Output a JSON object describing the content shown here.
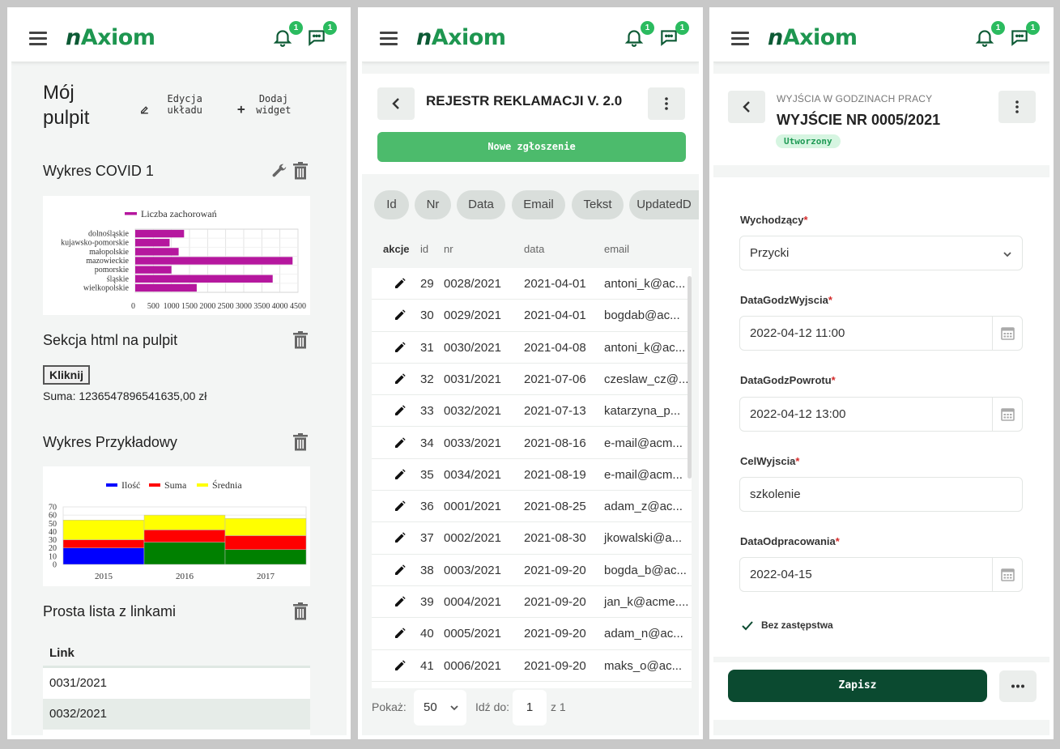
{
  "header": {
    "logo_prefix": "n",
    "logo_main": "Axiom",
    "notifications_count": "1",
    "messages_count": "1"
  },
  "dashboard": {
    "title": "Mój pulpit",
    "edit_layout_label": "Edycja układu",
    "add_widget_label": "Dodaj widget",
    "covid": {
      "title": "Wykres COVID 1",
      "chart_data": {
        "type": "bar",
        "orientation": "horizontal",
        "legend": [
          "Liczba zachorowań"
        ],
        "categories": [
          "dolnośląskie",
          "kujawsko-pomorskie",
          "małopolskie",
          "mazowieckie",
          "pomorskie",
          "śląskie",
          "wielkopolskie"
        ],
        "values": [
          1350,
          950,
          1200,
          4350,
          1000,
          3800,
          1700
        ],
        "x_ticks": [
          "0",
          "500",
          "1000",
          "1500",
          "2000",
          "2500",
          "3000",
          "3500",
          "4000",
          "4500"
        ],
        "xlim": [
          0,
          4500
        ],
        "color": "#b5179e"
      }
    },
    "html_section": {
      "title": "Sekcja html na pulpit",
      "button_label": "Kliknij",
      "sum_text": "Suma: 1236547896541635,00 zł"
    },
    "example_chart": {
      "title": "Wykres Przykładowy",
      "chart_data": {
        "type": "bar",
        "stacked": true,
        "categories": [
          "2015",
          "2016",
          "2017"
        ],
        "series": [
          {
            "name": "Ilość",
            "values": [
              20,
              27,
              18
            ],
            "color": "#0000ff"
          },
          {
            "name": "Suma",
            "values": [
              10,
              15,
              17
            ],
            "color": "#ff0000"
          },
          {
            "name": "Średnia",
            "values": [
              24,
              18,
              21
            ],
            "color": "#ffff00"
          }
        ],
        "y_ticks": [
          "0",
          "10",
          "20",
          "30",
          "40",
          "50",
          "60",
          "70"
        ],
        "ylim": [
          0,
          70
        ]
      }
    },
    "links": {
      "title": "Prosta lista z linkami",
      "column": "Link",
      "items": [
        "0031/2021",
        "0032/2021"
      ]
    }
  },
  "register": {
    "title": "REJESTR REKLAMACJI V. 2.0",
    "new_button": "Nowe zgłoszenie",
    "chips": [
      "Id",
      "Nr",
      "Data",
      "Email",
      "Tekst",
      "UpdatedD"
    ],
    "columns": [
      "akcje",
      "id",
      "nr",
      "data",
      "email"
    ],
    "rows": [
      {
        "id": "29",
        "nr": "0028/2021",
        "data": "2021-04-01",
        "email": "antoni_k@ac..."
      },
      {
        "id": "30",
        "nr": "0029/2021",
        "data": "2021-04-01",
        "email": "bogdab@ac..."
      },
      {
        "id": "31",
        "nr": "0030/2021",
        "data": "2021-04-08",
        "email": "antoni_k@ac..."
      },
      {
        "id": "32",
        "nr": "0031/2021",
        "data": "2021-07-06",
        "email": "czeslaw_cz@..."
      },
      {
        "id": "33",
        "nr": "0032/2021",
        "data": "2021-07-13",
        "email": "katarzyna_p..."
      },
      {
        "id": "34",
        "nr": "0033/2021",
        "data": "2021-08-16",
        "email": "e-mail@acm..."
      },
      {
        "id": "35",
        "nr": "0034/2021",
        "data": "2021-08-19",
        "email": "e-mail@acm..."
      },
      {
        "id": "36",
        "nr": "0001/2021",
        "data": "2021-08-25",
        "email": "adam_z@ac..."
      },
      {
        "id": "37",
        "nr": "0002/2021",
        "data": "2021-08-30",
        "email": "jkowalski@a..."
      },
      {
        "id": "38",
        "nr": "0003/2021",
        "data": "2021-09-20",
        "email": "bogda_b@ac..."
      },
      {
        "id": "39",
        "nr": "0004/2021",
        "data": "2021-09-20",
        "email": "jan_k@acme...."
      },
      {
        "id": "40",
        "nr": "0005/2021",
        "data": "2021-09-20",
        "email": "adam_n@ac..."
      },
      {
        "id": "41",
        "nr": "0006/2021",
        "data": "2021-09-20",
        "email": "maks_o@ac..."
      }
    ],
    "pager": {
      "show_label": "Pokaż:",
      "page_size": "50",
      "goto_label": "Idź do:",
      "page": "1",
      "of_label": "z 1"
    }
  },
  "exit_form": {
    "subtitle": "WYJŚCIA W GODZINACH PRACY",
    "title": "WYJŚCIE NR 0005/2021",
    "status": "Utworzony",
    "fields": {
      "wychodzacy": {
        "label": "Wychodzący",
        "value": "Przycki"
      },
      "wyjscie": {
        "label": "DataGodzWyjscia",
        "value": "2022-04-12 11:00"
      },
      "powrot": {
        "label": "DataGodzPowrotu",
        "value": "2022-04-12 13:00"
      },
      "cel": {
        "label": "CelWyjscia",
        "value": "szkolenie"
      },
      "odpracowanie": {
        "label": "DataOdpracowania",
        "value": "2022-04-15"
      }
    },
    "required_mark": "*",
    "checkbox_label": "Bez zastępstwa",
    "save_label": "Zapisz"
  },
  "colors": {
    "brand": "#1e9650",
    "brand_dark": "#0b4a30",
    "accent_green": "#4cbb6c",
    "badge": "#2bbb5f"
  }
}
